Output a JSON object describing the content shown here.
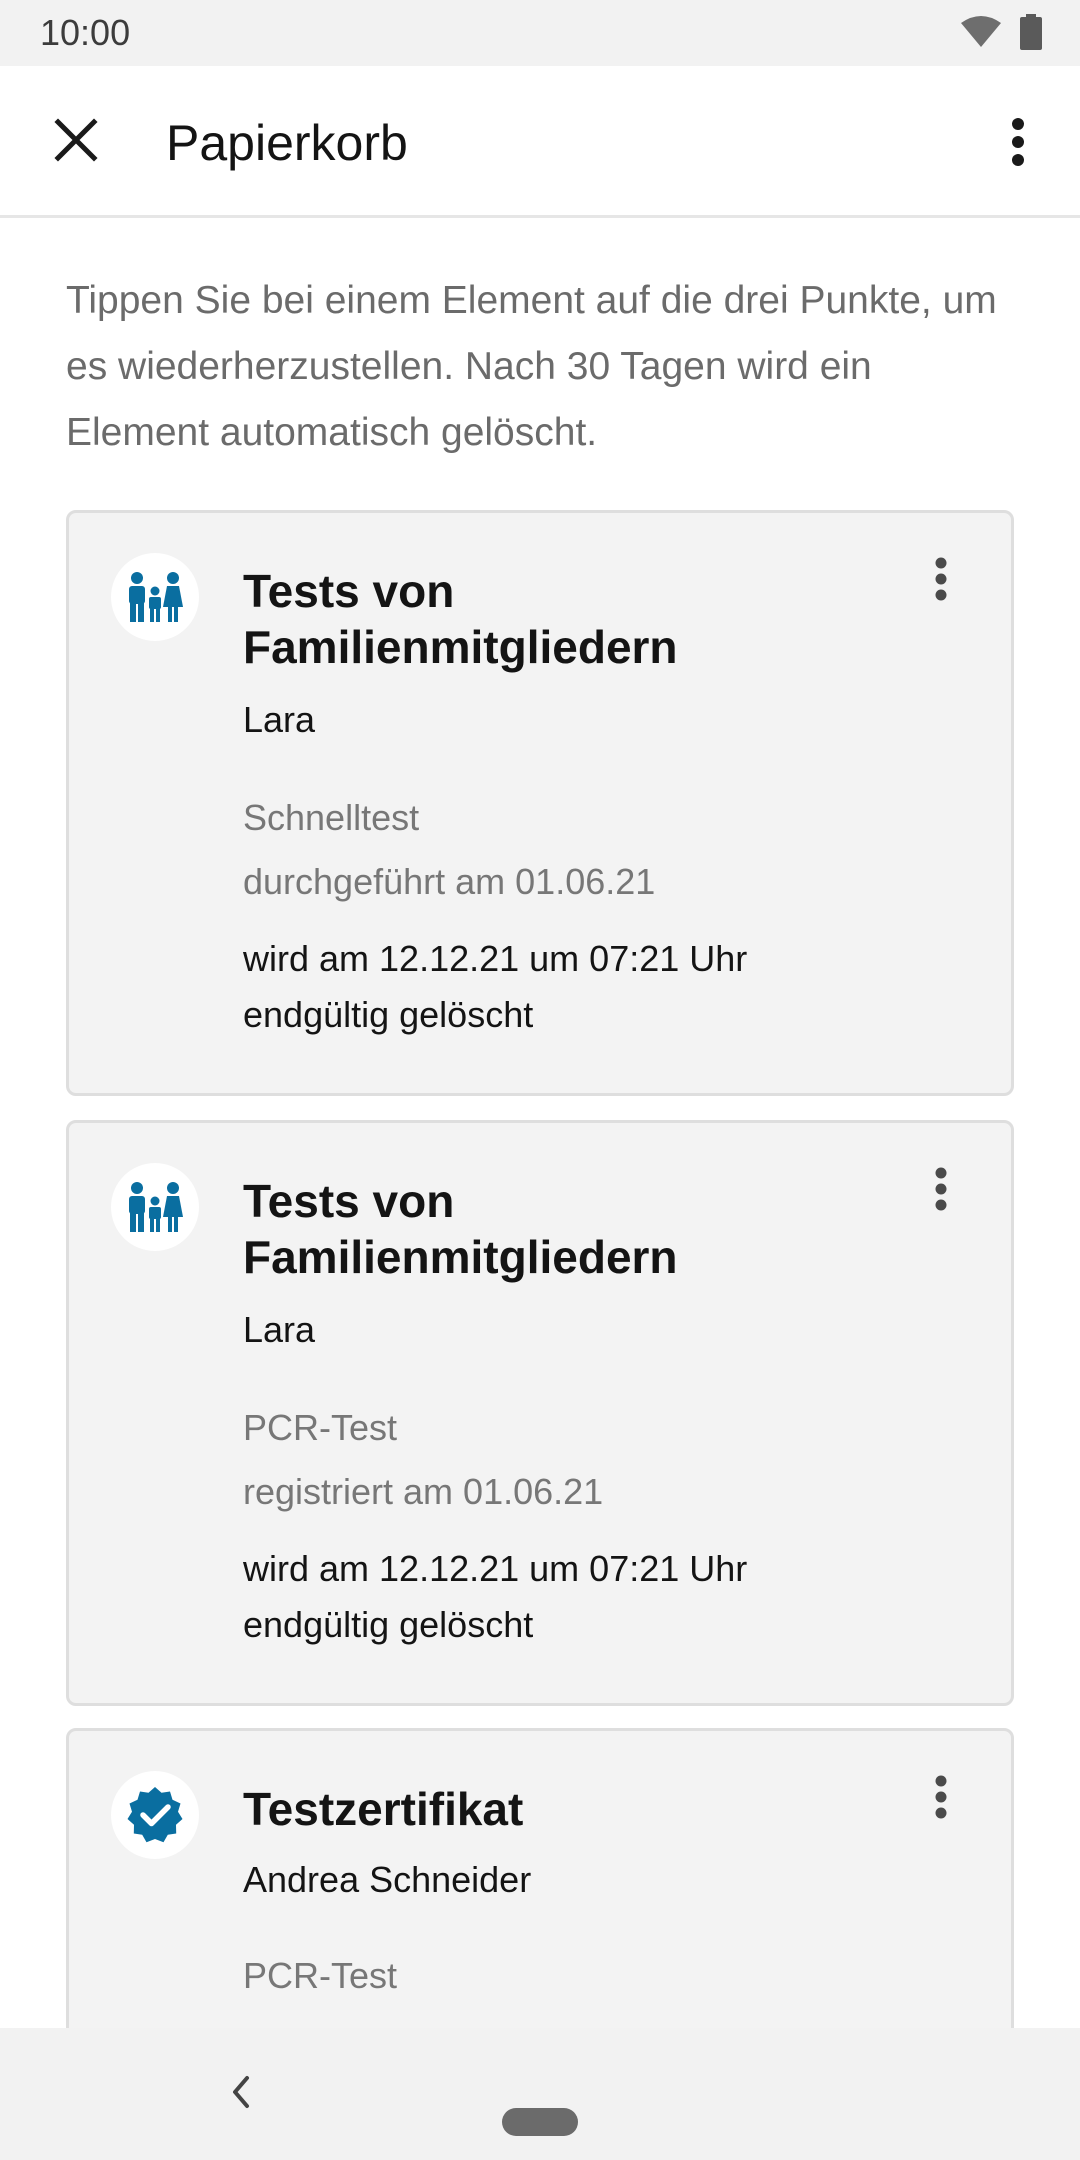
{
  "status_bar": {
    "time": "10:00",
    "icons": [
      "wifi-icon",
      "battery-icon"
    ]
  },
  "app_bar": {
    "title": "Papierkorb",
    "close_icon": "close-icon",
    "menu_icon": "more-vert-icon"
  },
  "intro_text": "Tippen Sie bei einem Element auf die drei Punkte, um es wiederherzustellen. Nach 30 Tagen wird ein Element automatisch gelöscht.",
  "items": [
    {
      "icon": "family-icon",
      "heading_line1": "Tests von",
      "heading_line2": "Familienmitgliedern",
      "person": "Lara",
      "type": "Schnelltest",
      "date": "durchgeführt am 01.06.21",
      "deletion_line1": "wird am 12.12.21 um 07:21 Uhr",
      "deletion_line2": "endgültig gelöscht"
    },
    {
      "icon": "family-icon",
      "heading_line1": "Tests von",
      "heading_line2": "Familienmitgliedern",
      "person": "Lara",
      "type": "PCR-Test",
      "date": "registriert am 01.06.21",
      "deletion_line1": "wird am 12.12.21 um 07:21 Uhr",
      "deletion_line2": "endgültig gelöscht"
    },
    {
      "icon": "verified-badge-icon",
      "heading_line1": "Testzertifikat",
      "person": "Andrea Schneider",
      "type": "PCR-Test"
    }
  ],
  "colors": {
    "accent": "#0a6ea0",
    "card_bg": "#f3f3f3",
    "secondary_text": "#777777"
  },
  "nav_bar": {
    "back_icon": "back-chevron-icon",
    "home_icon": "home-pill-icon"
  }
}
